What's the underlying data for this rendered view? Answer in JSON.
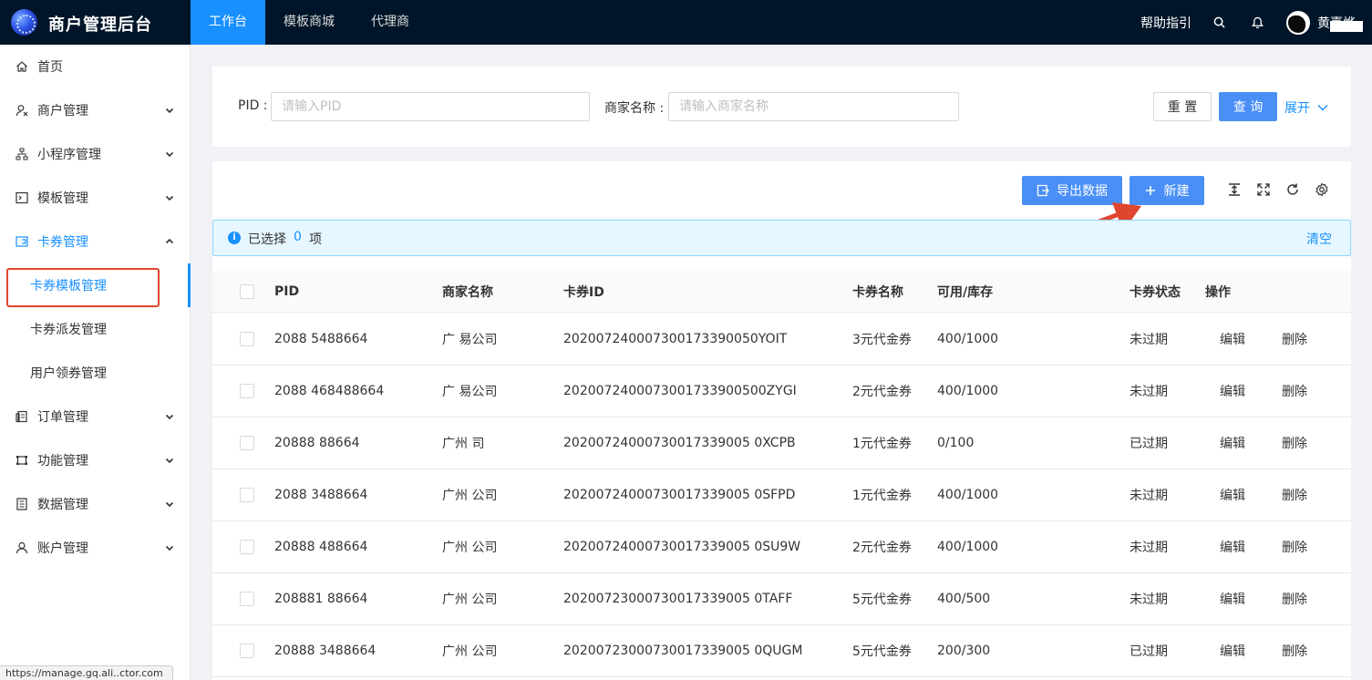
{
  "app": {
    "title": "商户管理后台"
  },
  "topnav": [
    {
      "label": "工作台"
    },
    {
      "label": "模板商城"
    },
    {
      "label": "代理商"
    }
  ],
  "header": {
    "help": "帮助指引",
    "username": "黄嘉烨"
  },
  "sidebar": {
    "items": [
      {
        "label": "首页",
        "icon": "home-icon"
      },
      {
        "label": "商户管理",
        "icon": "merchant-icon"
      },
      {
        "label": "小程序管理",
        "icon": "sitemap-icon"
      },
      {
        "label": "模板管理",
        "icon": "terminal-icon"
      },
      {
        "label": "卡券管理",
        "icon": "card-icon"
      },
      {
        "label": "卡券模板管理"
      },
      {
        "label": "卡券派发管理"
      },
      {
        "label": "用户领券管理"
      },
      {
        "label": "订单管理",
        "icon": "order-icon"
      },
      {
        "label": "功能管理",
        "icon": "function-icon"
      },
      {
        "label": "数据管理",
        "icon": "data-icon"
      },
      {
        "label": "账户管理",
        "icon": "user-icon"
      }
    ]
  },
  "status_url": "https://manage.gq.ali..ctor.com",
  "search": {
    "pid_label": "PID :",
    "pid_placeholder": "请输入PID",
    "name_label": "商家名称 :",
    "name_placeholder": "请输入商家名称",
    "reset": "重 置",
    "query": "查 询",
    "expand": "展开"
  },
  "toolbar": {
    "export": "导出数据",
    "create": "新建"
  },
  "selection": {
    "prefix": "已选择",
    "count": "0",
    "suffix": "项",
    "clear": "清空"
  },
  "table": {
    "columns": [
      "PID",
      "商家名称",
      "卡券ID",
      "卡券名称",
      "可用/库存",
      "卡券状态",
      "操作"
    ],
    "edit": "编辑",
    "delete": "删除",
    "rows": [
      {
        "pid": "2088 5488664",
        "merchant": "广 易公司",
        "card_id": "202007240007300173390050YOIT",
        "card_name": "3元代金券",
        "stock": "400/1000",
        "status": "未过期"
      },
      {
        "pid": "2088 468488664",
        "merchant": "广 易公司",
        "card_id": "2020072400073001733900500ZYGI",
        "card_name": "2元代金券",
        "stock": "400/1000",
        "status": "未过期"
      },
      {
        "pid": "20888 88664",
        "merchant": "广州 司",
        "card_id": "20200724000730017339005 0XCPB",
        "card_name": "1元代金券",
        "stock": "0/100",
        "status": "已过期"
      },
      {
        "pid": "2088 3488664",
        "merchant": "广州 公司",
        "card_id": "20200724000730017339005 0SFPD",
        "card_name": "1元代金券",
        "stock": "400/1000",
        "status": "未过期"
      },
      {
        "pid": "20888 488664",
        "merchant": "广州 公司",
        "card_id": "20200724000730017339005 0SU9W",
        "card_name": "2元代金券",
        "stock": "400/1000",
        "status": "未过期"
      },
      {
        "pid": "208881 88664",
        "merchant": "广州 公司",
        "card_id": "20200723000730017339005 0TAFF",
        "card_name": "5元代金券",
        "stock": "400/500",
        "status": "未过期"
      },
      {
        "pid": "20888 3488664",
        "merchant": "广州 公司",
        "card_id": "20200723000730017339005 0QUGM",
        "card_name": "5元代金券",
        "stock": "200/300",
        "status": "已过期"
      }
    ]
  },
  "colors": {
    "topbar": "#001529",
    "primary": "#1890ff",
    "button": "#4a8ff7",
    "highlight": "#e0452d",
    "alert_bg": "#e6f7ff"
  }
}
